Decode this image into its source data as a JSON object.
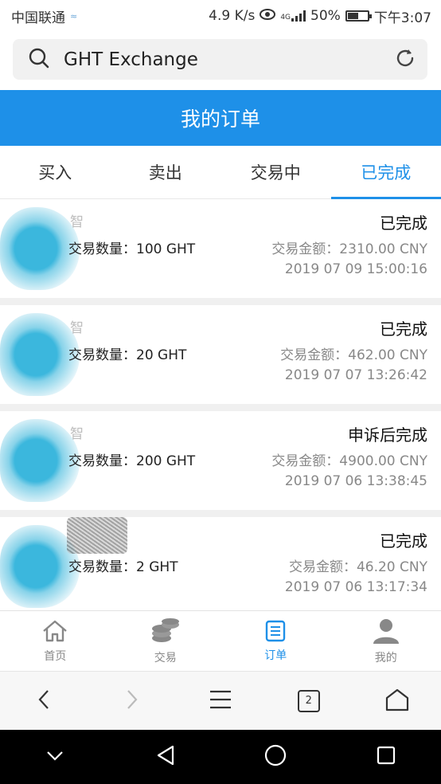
{
  "status_bar": {
    "carrier": "中国联通",
    "net_speed": "4.9 K/s",
    "network": "4G",
    "battery": "50%",
    "battery_level": 0.5,
    "time": "下午3:07"
  },
  "search": {
    "value": "GHT Exchange"
  },
  "header": {
    "title": "我的订单"
  },
  "tabs": [
    {
      "label": "买入",
      "active": false
    },
    {
      "label": "卖出",
      "active": false
    },
    {
      "label": "交易中",
      "active": false
    },
    {
      "label": "已完成",
      "active": true
    }
  ],
  "orders": [
    {
      "name": "智",
      "quantity": "交易数量：100 GHT",
      "status": "已完成",
      "amount": "交易金额：2310.00 CNY",
      "time": "2019 07 09 15:00:16"
    },
    {
      "name": "智",
      "quantity": "交易数量：20 GHT",
      "status": "已完成",
      "amount": "交易金额：462.00 CNY",
      "time": "2019 07 07 13:26:42"
    },
    {
      "name": "智",
      "quantity": "交易数量：200 GHT",
      "status": "申诉后完成",
      "amount": "交易金额：4900.00 CNY",
      "time": "2019 07 06 13:38:45"
    },
    {
      "name": "",
      "quantity": "交易数量：2 GHT",
      "status": "已完成",
      "amount": "交易金额：46.20 CNY",
      "time": "2019 07 06 13:17:34"
    }
  ],
  "bottom_nav": [
    {
      "label": "首页",
      "icon": "home-icon",
      "active": false
    },
    {
      "label": "交易",
      "icon": "coins-icon",
      "active": false
    },
    {
      "label": "订单",
      "icon": "orders-icon",
      "active": true
    },
    {
      "label": "我的",
      "icon": "user-icon",
      "active": false
    }
  ],
  "browser_bar": {
    "tab_count": "2"
  },
  "colors": {
    "accent": "#1e90e8",
    "header_bg": "#1e90e8",
    "muted_text": "#888888"
  }
}
